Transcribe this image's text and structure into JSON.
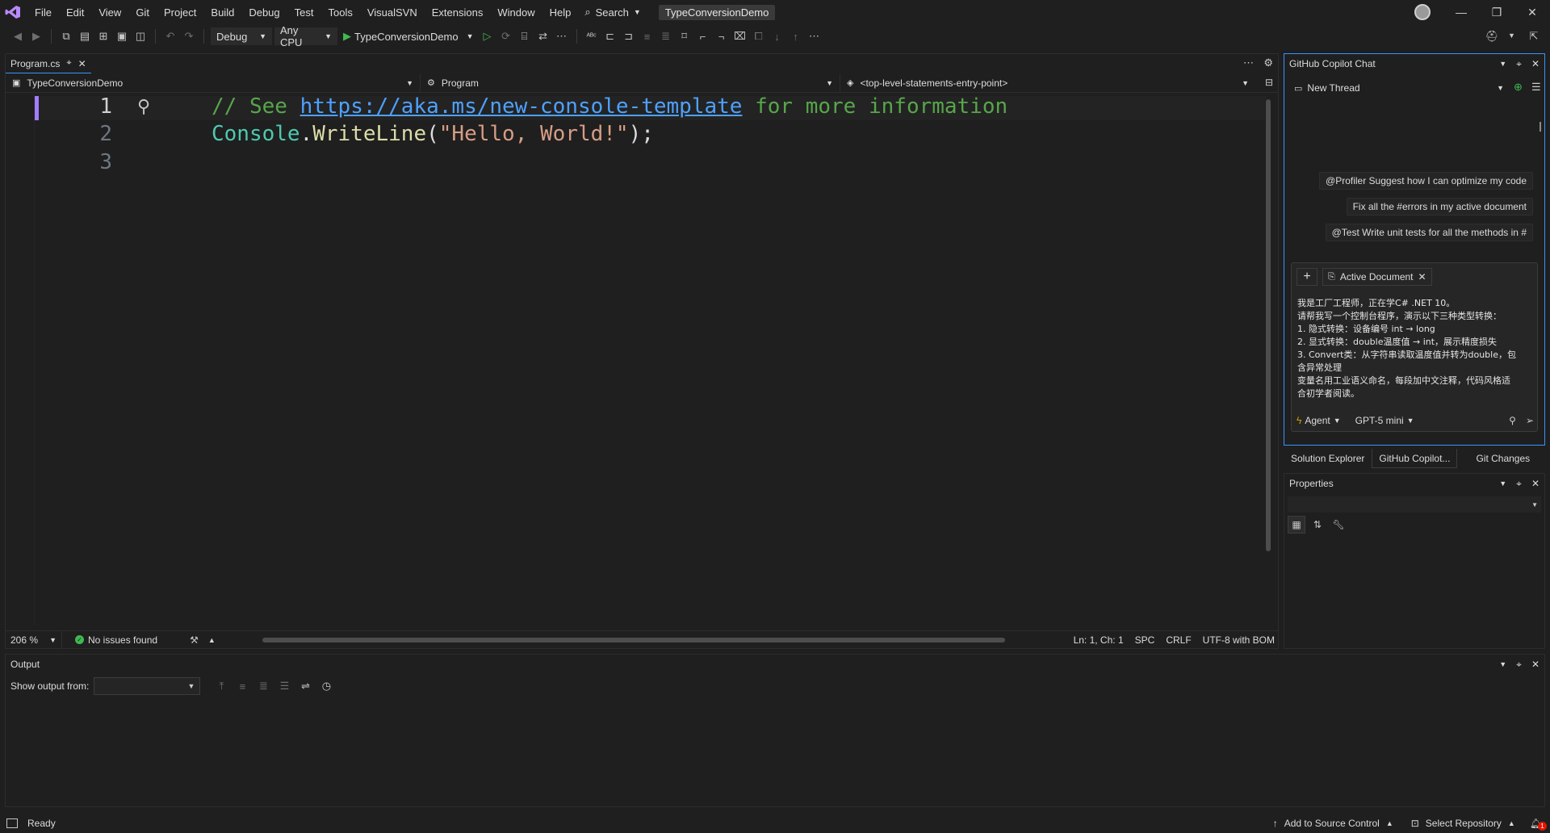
{
  "menu": {
    "items": [
      "File",
      "Edit",
      "View",
      "Git",
      "Project",
      "Build",
      "Debug",
      "Test",
      "Tools",
      "VisualSVN",
      "Extensions",
      "Window",
      "Help"
    ],
    "search_label": "Search",
    "solution_name": "TypeConversionDemo"
  },
  "window_controls": {
    "minimize": "—",
    "restore": "❐",
    "close": "✕"
  },
  "toolbar": {
    "configuration": "Debug",
    "platform": "Any CPU",
    "run_target": "TypeConversionDemo"
  },
  "editor": {
    "tab_label": "Program.cs",
    "nav_project": "TypeConversionDemo",
    "nav_type": "Program",
    "nav_member": "<top-level-statements-entry-point>",
    "line_numbers": [
      "1",
      "2",
      "3"
    ],
    "line1": {
      "comment_prefix": "// See ",
      "link": "https://aka.ms/new-console-template",
      "comment_suffix": " for more information"
    },
    "line2": {
      "type": "Console",
      "dot": ".",
      "method": "WriteLine",
      "open": "(",
      "string": "\"Hello, World!\"",
      "close": ");"
    },
    "zoom": "206 %",
    "issues": "No issues found",
    "position": "Ln: 1, Ch: 1",
    "whitespace": "SPC",
    "line_endings": "CRLF",
    "encoding": "UTF-8 with BOM"
  },
  "copilot": {
    "title": "GitHub Copilot Chat",
    "thread": "New Thread",
    "suggestions": [
      "@Profiler Suggest how I can optimize my code",
      "Fix all the #errors in my active document",
      "@Test Write unit tests for all the methods in #"
    ],
    "context_chip": "Active Document",
    "prompt_lines": [
      "我是工厂工程师，正在学C# .NET 10。",
      "请帮我写一个控制台程序，演示以下三种类型转换：",
      "1. 隐式转换：设备编号 int → long",
      "2. 显式转换：double温度值 → int，展示精度损失",
      "3. Convert类：从字符串读取温度值并转为double，包",
      "含异常处理",
      "变量名用工业语义命名，每段加中文注释，代码风格适",
      "合初学者阅读。"
    ],
    "mode": "Agent",
    "model": "GPT-5 mini"
  },
  "panel_tabs": [
    "Solution Explorer",
    "GitHub Copilot...",
    "Git Changes"
  ],
  "properties": {
    "title": "Properties"
  },
  "output": {
    "title": "Output",
    "show_from_label": "Show output from:"
  },
  "status": {
    "ready": "Ready",
    "add_source_control": "Add to Source Control",
    "select_repository": "Select Repository",
    "notification_count": "1"
  },
  "colors": {
    "accent": "#3794ff",
    "change_bar": "#a37cff",
    "success": "#3fb950",
    "comment": "#57a64a",
    "string": "#d69d85"
  }
}
